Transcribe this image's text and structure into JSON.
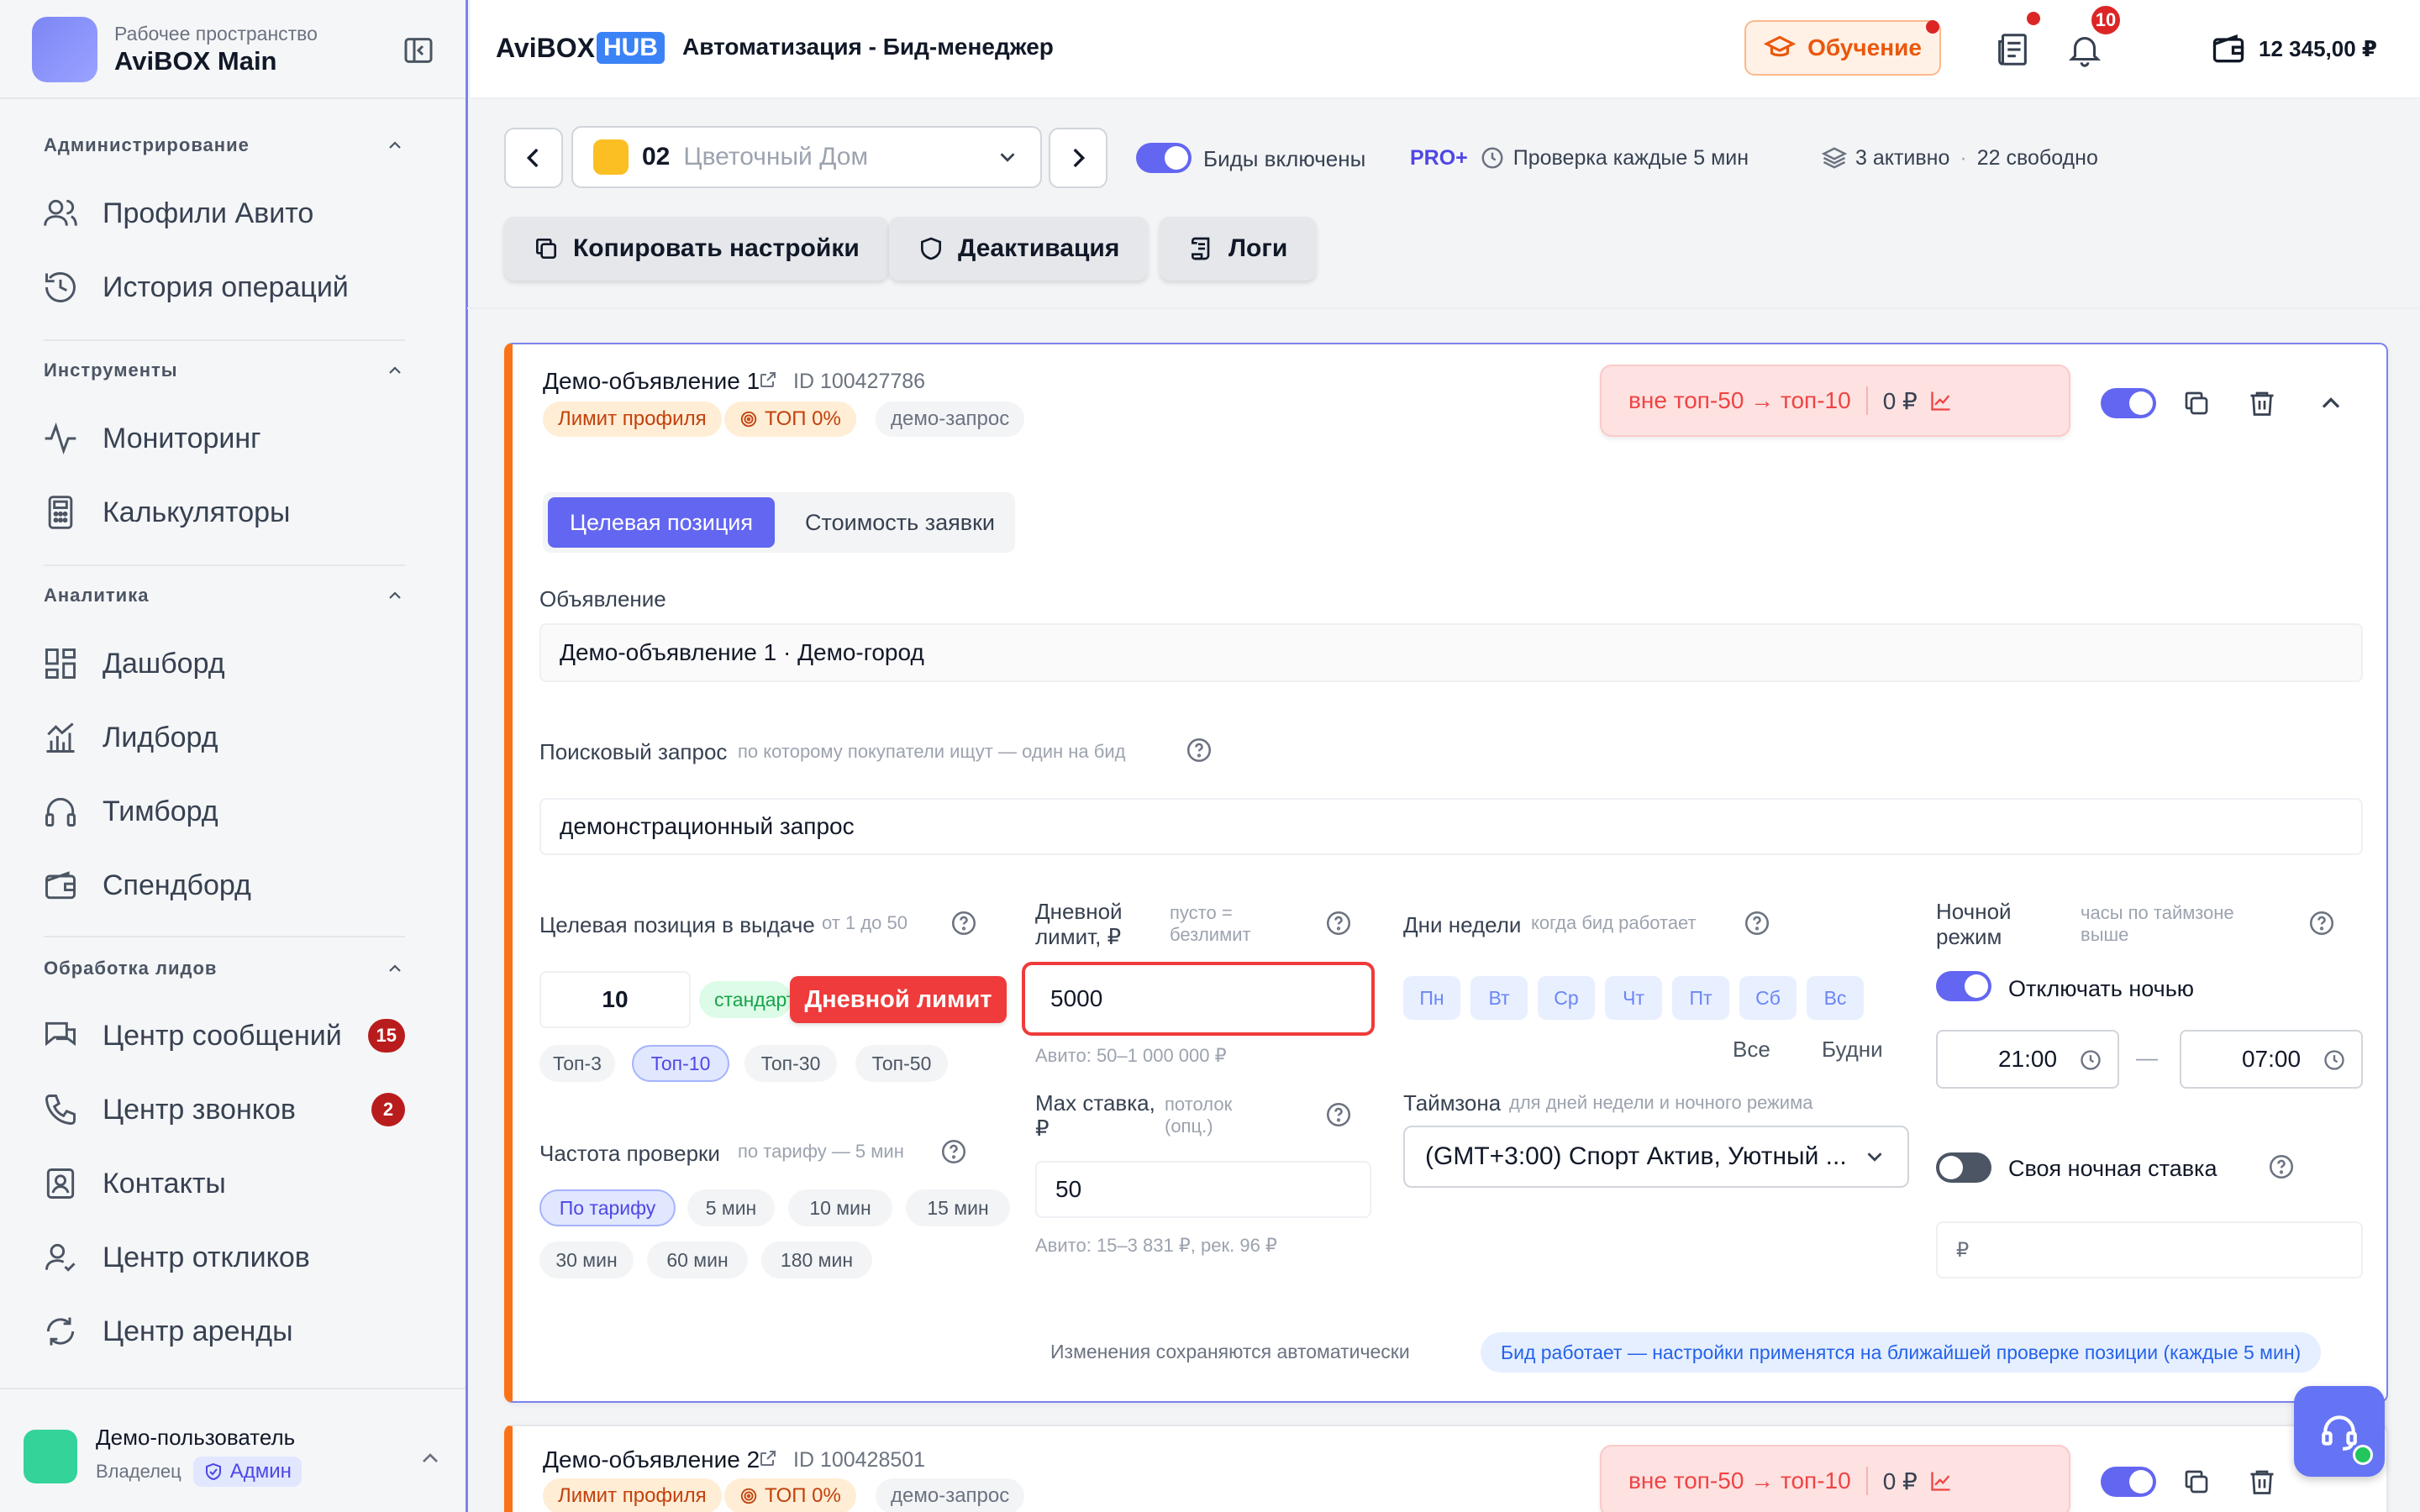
{
  "workspace": {
    "subtitle": "Рабочее пространство",
    "name": "AviBOX Main"
  },
  "sidebar": {
    "sections": [
      {
        "title": "Администрирование",
        "items": [
          {
            "label": "Профили Авито",
            "icon": "users-icon"
          },
          {
            "label": "История операций",
            "icon": "history-icon"
          }
        ]
      },
      {
        "title": "Инструменты",
        "items": [
          {
            "label": "Мониторинг",
            "icon": "activity-icon"
          },
          {
            "label": "Калькуляторы",
            "icon": "calculator-icon"
          }
        ]
      },
      {
        "title": "Аналитика",
        "items": [
          {
            "label": "Дашборд",
            "icon": "dashboard-icon"
          },
          {
            "label": "Лидборд",
            "icon": "chart-icon"
          },
          {
            "label": "Тимборд",
            "icon": "headphones-icon"
          },
          {
            "label": "Спендборд",
            "icon": "wallet-icon"
          }
        ]
      },
      {
        "title": "Обработка лидов",
        "items": [
          {
            "label": "Центр сообщений",
            "icon": "messages-icon",
            "badge": "15"
          },
          {
            "label": "Центр звонков",
            "icon": "phone-icon",
            "badge": "2"
          },
          {
            "label": "Контакты",
            "icon": "contact-icon"
          },
          {
            "label": "Центр откликов",
            "icon": "user-response-icon"
          },
          {
            "label": "Центр аренды",
            "icon": "refresh-icon"
          }
        ]
      }
    ],
    "user": {
      "name": "Демо-пользователь",
      "role": "Владелец",
      "badge": "Админ"
    }
  },
  "header": {
    "brand_a": "AviBOX",
    "brand_b": "HUB",
    "title": "Автоматизация - Бид-менеджер",
    "learn_label": "Обучение",
    "notif_count": "10",
    "balance": "12 345,00 ₽"
  },
  "toolbar": {
    "profile_num": "02",
    "profile_name": "Цветочный Дом",
    "bids_label": "Биды включены",
    "plan": "PRO+",
    "check_label": "Проверка каждые 5 мин",
    "active_label": "3 активно",
    "dot_sep": "·",
    "free_label": "22 свободно",
    "copy_label": "Копировать настройки",
    "deact_label": "Деактивация",
    "logs_label": "Логи"
  },
  "card1": {
    "title": "Демо-объявление 1",
    "id": "ID 100427786",
    "tags": [
      "Лимит профиля",
      "ТОП 0%",
      "демо-запрос"
    ],
    "status_range": "вне топ-50 → топ-10",
    "status_price": "0 ₽",
    "tabs": [
      "Целевая позиция",
      "Стоимость заявки"
    ],
    "ad_label": "Объявление",
    "ad_value": "Демо-объявление 1 · Демо-город",
    "query_label": "Поисковый запрос",
    "query_hint": "по которому покупатели ищут — один на бид",
    "query_value": "демонстрационный запрос",
    "target": {
      "label": "Целевая позиция в выдаче",
      "hint": "от 1 до 50",
      "value": "10",
      "std": "стандарт",
      "chips": [
        "Топ-3",
        "Топ-10",
        "Топ-30",
        "Топ-50"
      ],
      "active": "Топ-10"
    },
    "freq": {
      "label": "Частота проверки",
      "hint": "по тарифу — 5 мин",
      "chips": [
        "По тарифу",
        "5 мин",
        "10 мин",
        "15 мин",
        "30 мин",
        "60 мин",
        "180 мин"
      ]
    },
    "daily": {
      "label_1": "Дневной",
      "label_2": "лимит, ₽",
      "hint_1": "пусто =",
      "hint_2": "безлимит",
      "value": "5000",
      "note": "Авито: 50–1 000 000 ₽",
      "tooltip": "Дневной лимит"
    },
    "maxbid": {
      "label_1": "Max ставка,",
      "label_2": "₽",
      "hint_1": "потолок",
      "hint_2": "(опц.)",
      "value": "50",
      "note": "Авито: 15–3 831 ₽, рек. 96 ₽"
    },
    "days": {
      "label": "Дни недели",
      "hint": "когда бид работает",
      "items": [
        "Пн",
        "Вт",
        "Ср",
        "Чт",
        "Пт",
        "Сб",
        "Вс"
      ],
      "all": "Все",
      "weekdays": "Будни"
    },
    "tz": {
      "label": "Таймзона",
      "hint": "для дней недели и ночного режима",
      "value": "(GMT+3:00) Спорт Актив, Уютный ..."
    },
    "night": {
      "label_1": "Ночной",
      "label_2": "режим",
      "hint_1": "часы по таймзоне",
      "hint_2": "выше",
      "toggle_label": "Отключать ночью",
      "from": "21:00",
      "dash": "—",
      "to": "07:00",
      "own_label": "Своя ночная ставка",
      "currency": "₽"
    },
    "footer_note": "Изменения сохраняются автоматически",
    "footer_pill": "Бид работает — настройки применятся на ближайшей проверке позиции (каждые 5 мин)"
  },
  "card2": {
    "title": "Демо-объявление 2",
    "id": "ID 100428501",
    "tags": [
      "Лимит профиля",
      "ТОП 0%",
      "демо-запрос"
    ],
    "status_range": "вне топ-50 → топ-10",
    "status_price": "0 ₽"
  },
  "colors": {
    "accent": "#6366f1",
    "orange": "#f97316",
    "danger": "#ef3b3b",
    "sidebar_bg": "#f5f6f8"
  }
}
